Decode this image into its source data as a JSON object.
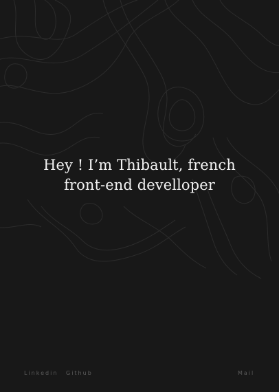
{
  "hero": {
    "line1": "Hey ! I’m Thibault, french",
    "line2": "front-end develloper"
  },
  "footer": {
    "linkedin": "Linkedin",
    "github": "Github",
    "mail": "Mail"
  },
  "colors": {
    "background": "#181818",
    "heading": "#f2f2f2",
    "link": "#5c5c5c",
    "contour": "#2c2c2c"
  }
}
